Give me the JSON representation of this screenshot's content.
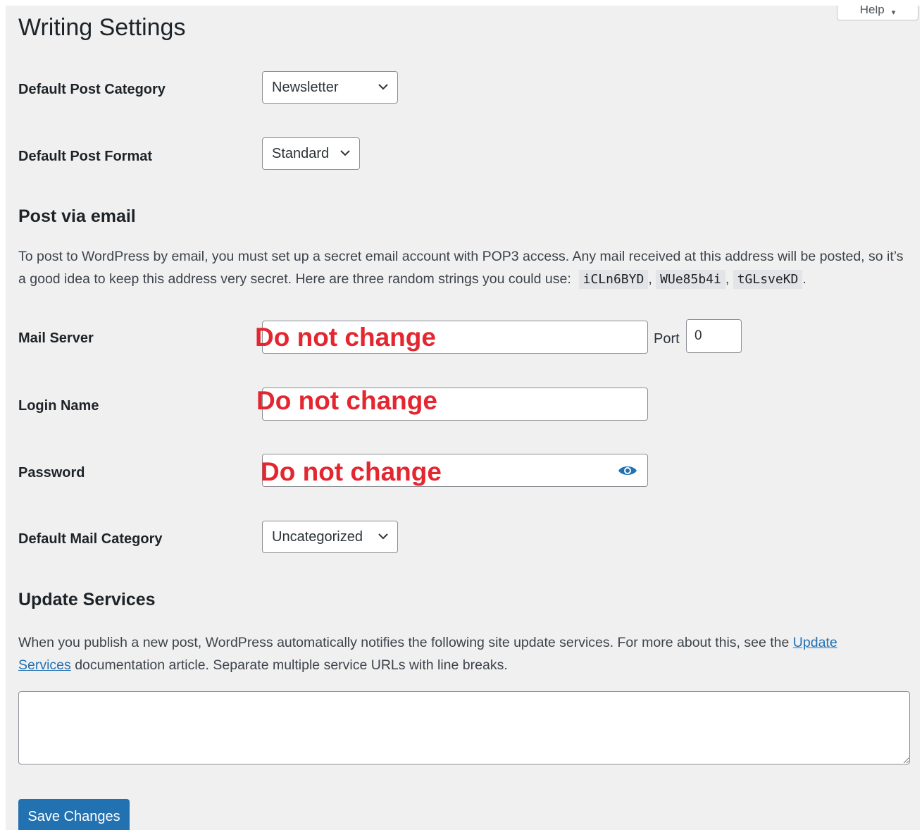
{
  "help": {
    "label": "Help",
    "arrow": "▾"
  },
  "page_title": "Writing Settings",
  "fields": {
    "default_post_category": {
      "label": "Default Post Category",
      "value": "Newsletter"
    },
    "default_post_format": {
      "label": "Default Post Format",
      "value": "Standard"
    },
    "mail_server": {
      "label": "Mail Server",
      "overlay": "Do not change",
      "port_label": "Port",
      "port_value": "0"
    },
    "login_name": {
      "label": "Login Name",
      "overlay": "Do not change"
    },
    "password": {
      "label": "Password",
      "overlay": "Do not change"
    },
    "default_mail_category": {
      "label": "Default Mail Category",
      "value": "Uncategorized"
    }
  },
  "post_via_email": {
    "heading": "Post via email",
    "text_before": "To post to WordPress by email, you must set up a secret email account with POP3 access. Any mail received at this address will be posted, so it’s a good idea to keep this address very secret. Here are three random strings you could use:",
    "codes": [
      "iCLn6BYD",
      "WUe85b4i",
      "tGLsveKD"
    ],
    "sep": ",",
    "end": "."
  },
  "update_services": {
    "heading": "Update Services",
    "text_before": "When you publish a new post, WordPress automatically notifies the following site update services. For more about this, see the",
    "link": "Update Services",
    "text_after": "documentation article. Separate multiple service URLs with line breaks.",
    "textarea_value": ""
  },
  "save_button": "Save Changes",
  "colors": {
    "accent": "#2271b1",
    "overlay_red": "#e3262f",
    "background": "#f0f0f1"
  }
}
